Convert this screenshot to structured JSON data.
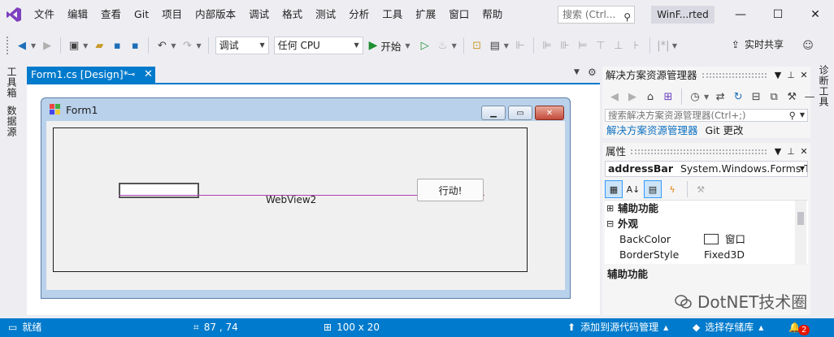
{
  "menu": {
    "items": [
      "文件",
      "编辑",
      "查看",
      "Git",
      "项目",
      "内部版本",
      "调试",
      "格式",
      "测试",
      "分析",
      "工具",
      "扩展",
      "窗口",
      "帮助"
    ]
  },
  "search": {
    "placeholder": "搜索 (Ctrl..."
  },
  "solution": {
    "name": "WinF...rted"
  },
  "toolbar": {
    "config": "调试",
    "platform": "任何 CPU",
    "start_label": "开始",
    "live_share": "实时共享"
  },
  "left_rail": {
    "toolbox": "工具箱",
    "datasource": "数据源"
  },
  "right_rail": {
    "diagnostics": "诊断工具"
  },
  "document": {
    "tab_title": "Form1.cs [Design]*"
  },
  "form": {
    "title": "Form1",
    "webview_label": "WebView2",
    "go_button": "行动!"
  },
  "solution_explorer": {
    "title": "解决方案资源管理器",
    "search_placeholder": "搜索解决方案资源管理器(Ctrl+;)",
    "tabs": [
      "解决方案资源管理器",
      "Git 更改"
    ]
  },
  "properties": {
    "title": "属性",
    "object_name": "addressBar",
    "object_type": "System.Windows.Forms.Tex",
    "categories": [
      {
        "toggle": "⊞",
        "name": "辅助功能"
      },
      {
        "toggle": "⊟",
        "name": "外观"
      }
    ],
    "rows": [
      {
        "name": "BackColor",
        "value": "窗口"
      },
      {
        "name": "BorderStyle",
        "value": "Fixed3D"
      }
    ],
    "description_title": "辅助功能"
  },
  "watermark": {
    "text": "DotNET技术圈"
  },
  "status": {
    "ready": "就绪",
    "position": "87 , 74",
    "size": "100 x 20",
    "add_source_control": "添加到源代码管理",
    "select_repo": "选择存储库",
    "notifications": "2"
  },
  "colors": {
    "accent": "#007acc",
    "title_bg": "#eeeef2",
    "form_caption": "#b9d1ea",
    "webview_outline": "#b040b0"
  }
}
